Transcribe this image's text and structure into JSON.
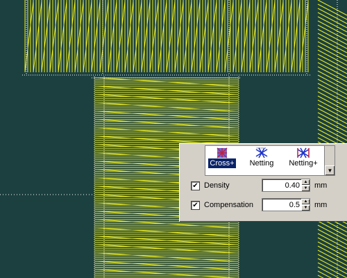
{
  "canvas": {
    "background": "#1c4040",
    "stitch_color": "#f0f020",
    "guide_color": "#ffffff"
  },
  "panel": {
    "fill_styles": [
      {
        "label": "Cross+",
        "icon": "cross-plus-fill-icon",
        "selected": true
      },
      {
        "label": "Netting",
        "icon": "netting-fill-icon",
        "selected": false
      },
      {
        "label": "Netting+",
        "icon": "netting-plus-fill-icon",
        "selected": false
      }
    ],
    "density": {
      "checked": true,
      "label": "Density",
      "value": "0.40",
      "unit": "mm"
    },
    "compensation": {
      "checked": true,
      "label": "Compensation",
      "value": "0.5",
      "unit": "mm"
    }
  }
}
